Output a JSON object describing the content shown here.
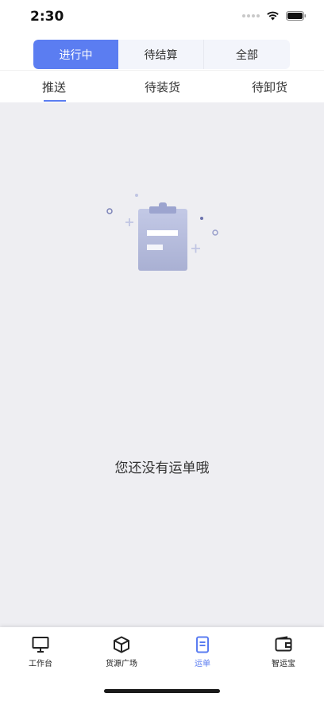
{
  "status_bar": {
    "time": "2:30"
  },
  "segments": [
    {
      "label": "进行中",
      "active": true
    },
    {
      "label": "待结算",
      "active": false
    },
    {
      "label": "全部",
      "active": false
    }
  ],
  "tabs": [
    {
      "label": "推送",
      "active": true
    },
    {
      "label": "待装货",
      "active": false
    },
    {
      "label": "待卸货",
      "active": false
    }
  ],
  "empty_state": {
    "message": "您还没有运单哦",
    "icon": "clipboard-icon"
  },
  "tabbar": [
    {
      "label": "工作台",
      "icon": "monitor-icon",
      "active": false
    },
    {
      "label": "货源广场",
      "icon": "box-icon",
      "active": false
    },
    {
      "label": "运单",
      "icon": "document-icon",
      "active": true
    },
    {
      "label": "智运宝",
      "icon": "wallet-icon",
      "active": false
    }
  ],
  "colors": {
    "accent": "#5b7df1",
    "background": "#eeeef2"
  }
}
